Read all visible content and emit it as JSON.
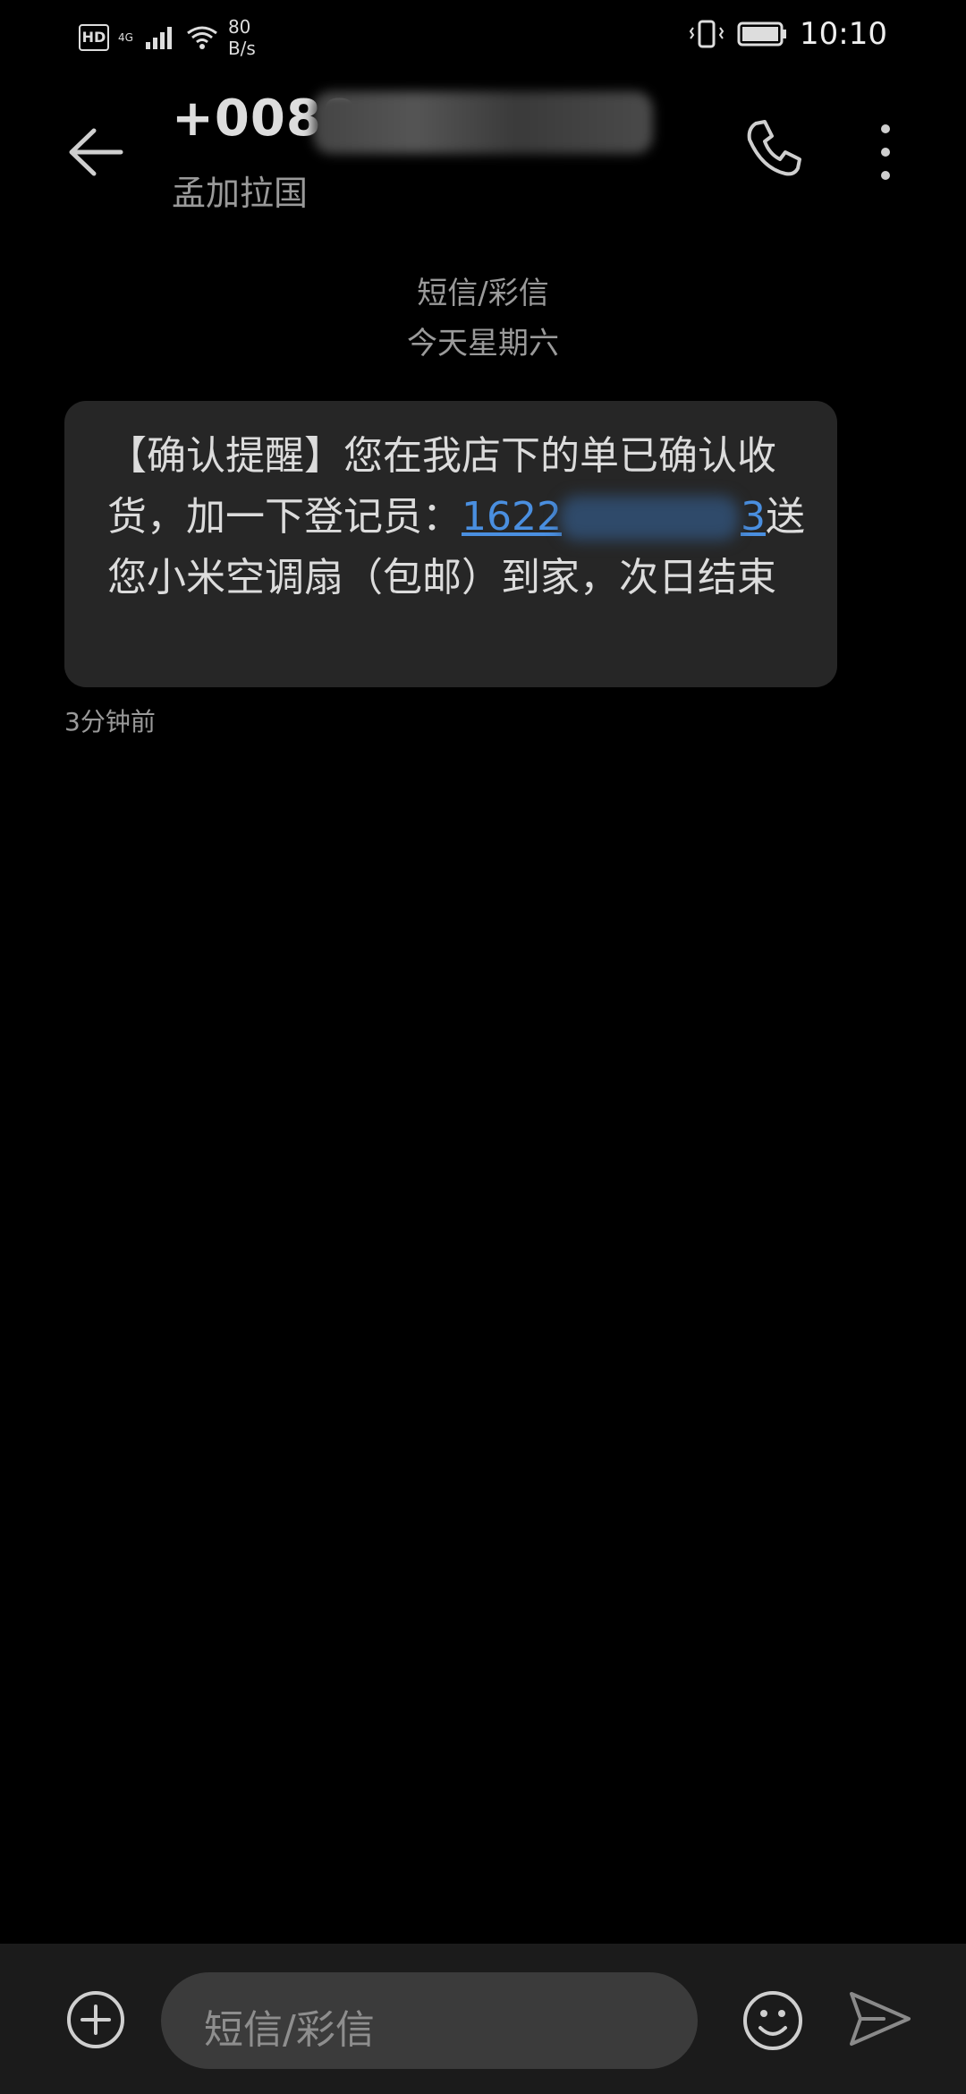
{
  "statusbar": {
    "hd": "HD",
    "network": "4G",
    "speed_value": "80",
    "speed_unit": "B/s",
    "time": "10:10"
  },
  "header": {
    "number_prefix": "+0088",
    "country": "孟加拉国"
  },
  "divider": {
    "type": "短信/彩信",
    "date": "今天星期六"
  },
  "message": {
    "text_before": "【确认提醒】您在我店下的单已确认收货，加一下登记员：",
    "link_visible": "1622",
    "link_tail": "3",
    "text_after": "送您小米空调扇（包邮）到家，次日结束",
    "time": "3分钟前"
  },
  "composer": {
    "placeholder": "短信/彩信"
  },
  "icons": {
    "back": "back-arrow-icon",
    "phone": "phone-icon",
    "more": "more-vertical-icon",
    "add": "add-circle-icon",
    "emoji": "emoji-icon",
    "send": "send-icon"
  }
}
